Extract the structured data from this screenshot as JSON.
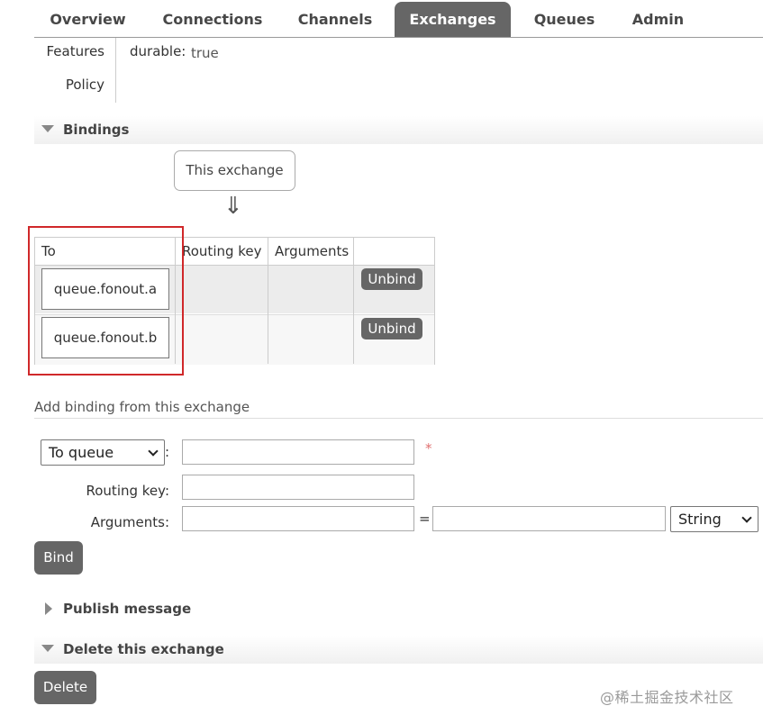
{
  "nav": {
    "tabs": [
      {
        "label": "Overview"
      },
      {
        "label": "Connections"
      },
      {
        "label": "Channels"
      },
      {
        "label": "Exchanges"
      },
      {
        "label": "Queues"
      },
      {
        "label": "Admin"
      }
    ],
    "active": "Exchanges"
  },
  "features": {
    "features_label": "Features",
    "policy_label": "Policy",
    "durable_key": "durable:",
    "durable_value": "true"
  },
  "bindings": {
    "title": "Bindings",
    "source_label": "This exchange",
    "arrow": "⇓",
    "headers": {
      "to": "To",
      "routing_key": "Routing key",
      "arguments": "Arguments"
    },
    "rows": [
      {
        "to": "queue.fonout.a",
        "routing_key": "",
        "arguments": "",
        "action": "Unbind"
      },
      {
        "to": "queue.fonout.b",
        "routing_key": "",
        "arguments": "",
        "action": "Unbind"
      }
    ]
  },
  "add_binding": {
    "title": "Add binding from this exchange",
    "destination_type": "To queue",
    "destination_value": "",
    "required_mark": "*",
    "routing_key_label": "Routing key:",
    "routing_key_value": "",
    "arguments_label": "Arguments:",
    "argument_key": "",
    "equals": "=",
    "argument_value": "",
    "argument_type": "String",
    "colon": ":",
    "bind_label": "Bind"
  },
  "publish": {
    "title": "Publish message"
  },
  "delete": {
    "title": "Delete this exchange",
    "button_label": "Delete"
  },
  "watermark": "@稀土掘金技术社区",
  "colors": {
    "accent": "#666666",
    "highlight": "#d0282a",
    "required": "#e07070"
  }
}
